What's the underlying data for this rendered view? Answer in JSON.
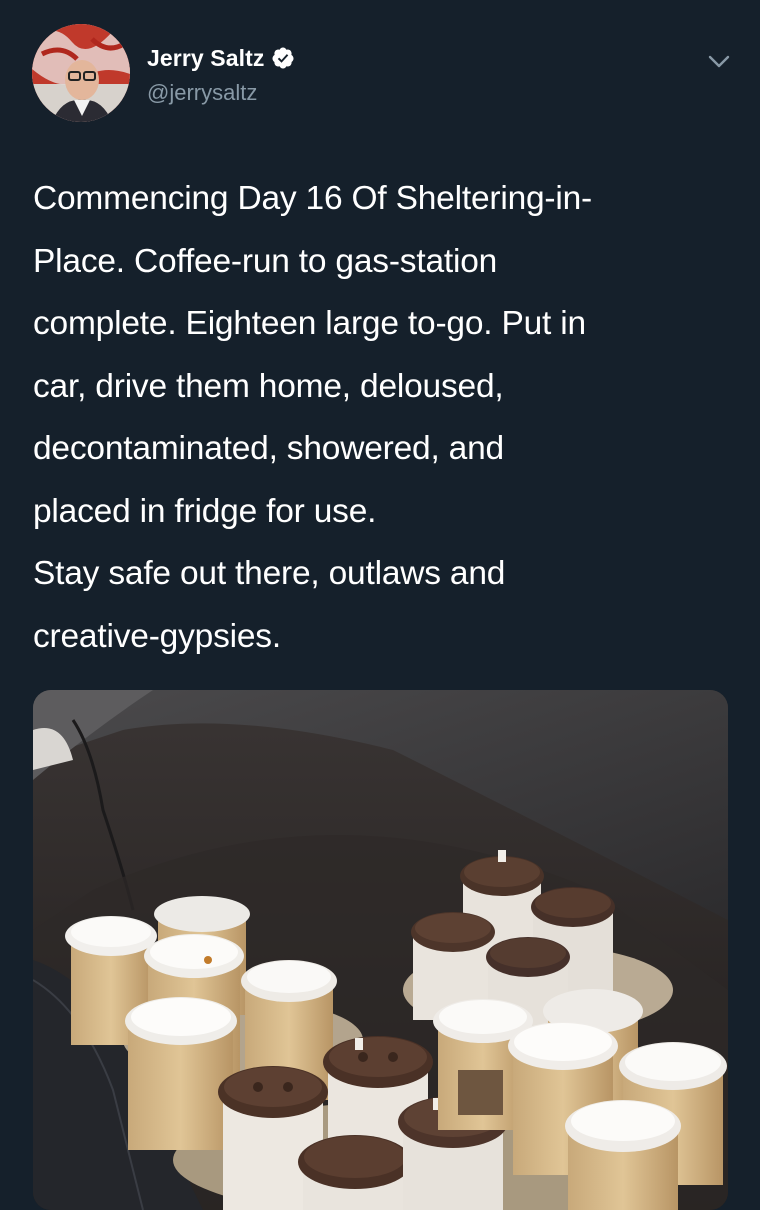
{
  "user": {
    "display_name": "Jerry Saltz",
    "handle": "@jerrysaltz",
    "verified": true,
    "verified_icon": "verified-badge-icon",
    "avatar_icon": "profile-photo"
  },
  "menu_icon": "chevron-down-icon",
  "tweet": {
    "lines": [
      "Commencing Day 16 Of Sheltering-in-",
      "Place. Coffee-run to gas-station",
      "complete. Eighteen large to-go.  Put in",
      "car, drive them home, deloused,",
      "decontaminated, showered, and",
      "placed in fridge for use.",
      "Stay safe out there, outlaws and",
      "creative-gypsies."
    ]
  },
  "media": {
    "kind": "photo",
    "subject": "coffee cups on car floor"
  },
  "colors": {
    "background": "#15202b",
    "text_primary": "#ffffff",
    "text_secondary": "#8899a6",
    "verified": "#ffffff"
  }
}
